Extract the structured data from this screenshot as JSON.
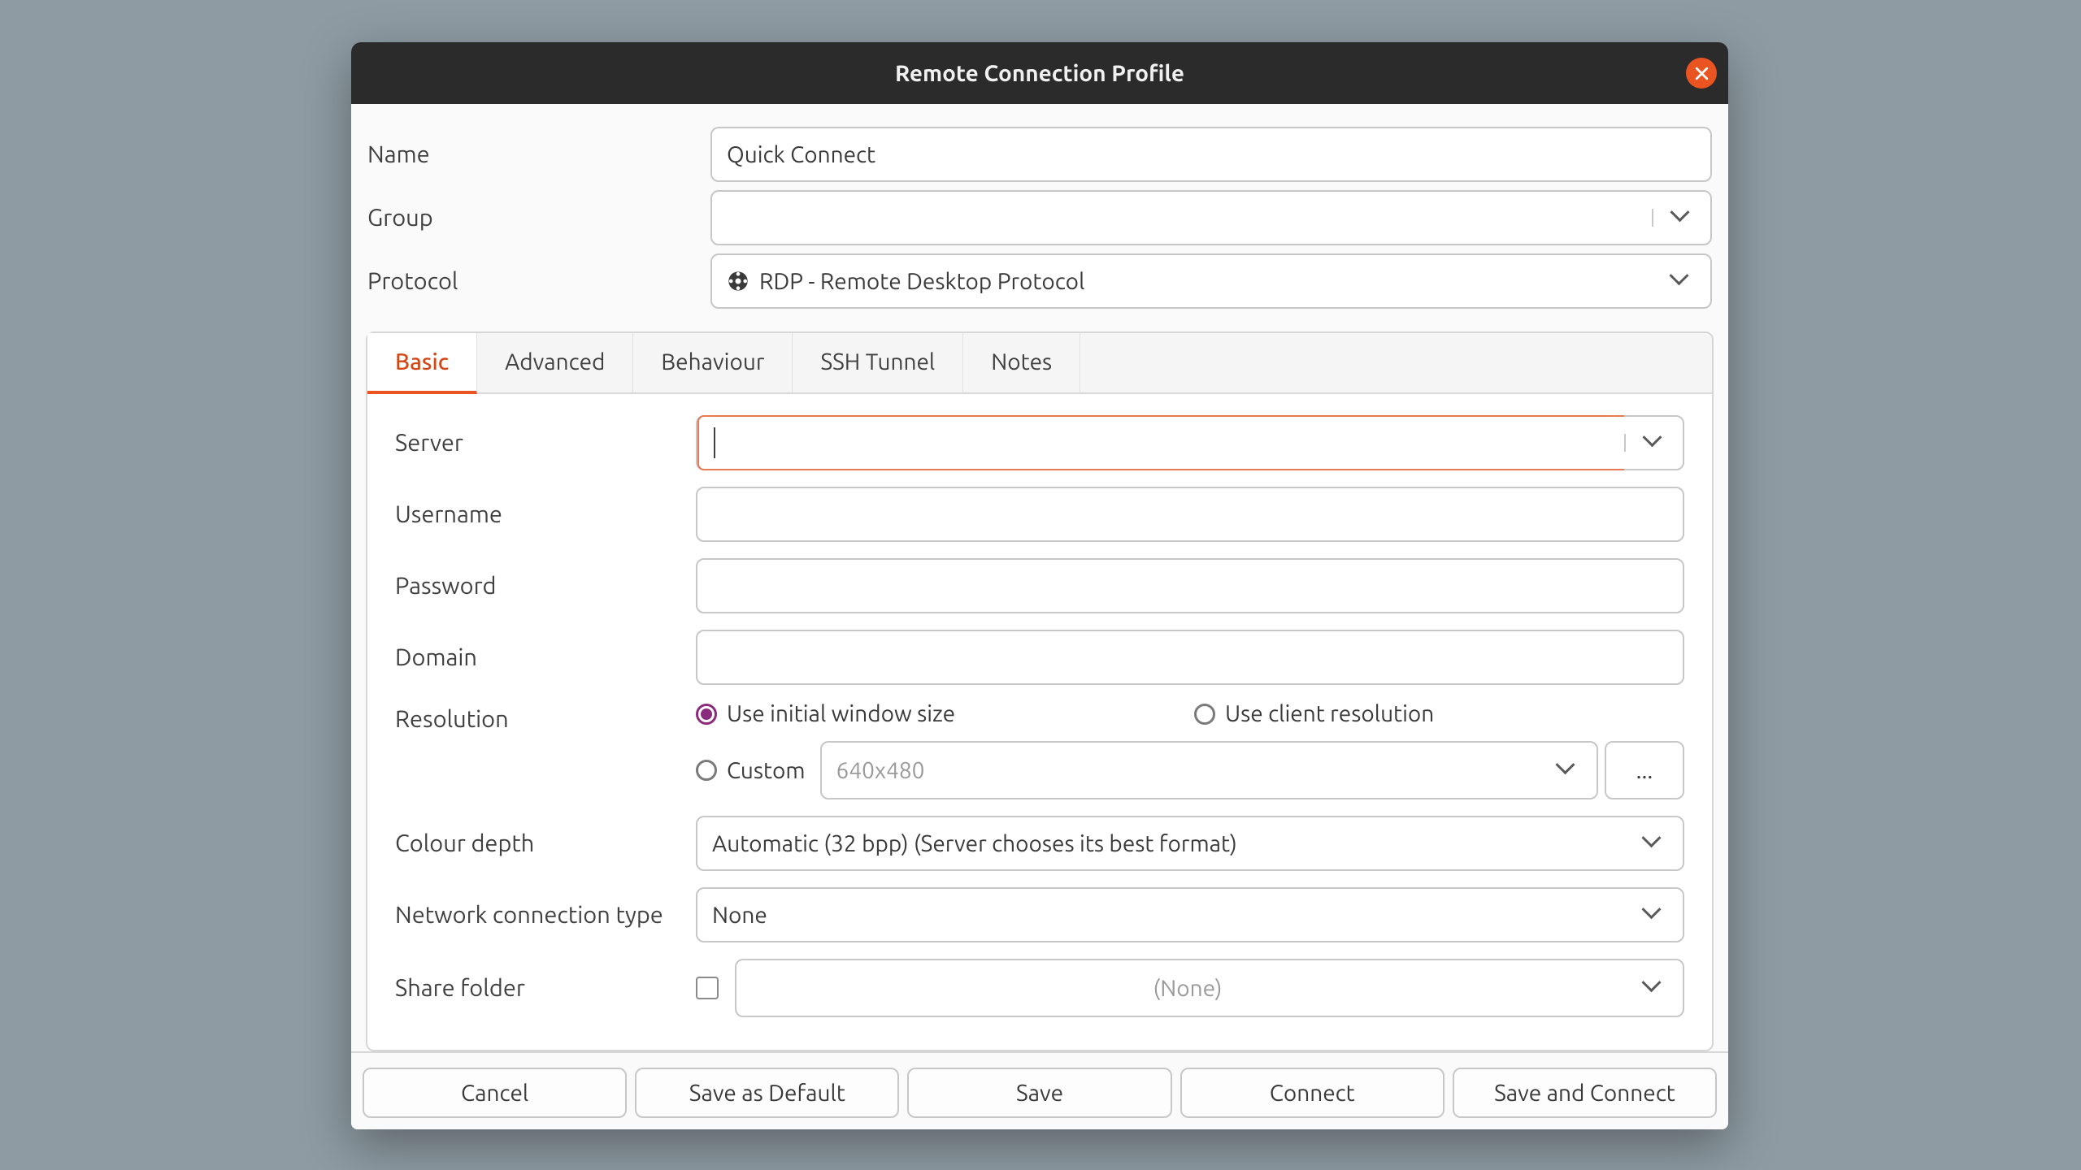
{
  "title": "Remote Connection Profile",
  "labels": {
    "name": "Name",
    "group": "Group",
    "protocol": "Protocol"
  },
  "values": {
    "name": "Quick Connect",
    "group": "",
    "protocol": "RDP - Remote Desktop Protocol"
  },
  "tabs": {
    "basic": "Basic",
    "advanced": "Advanced",
    "behaviour": "Behaviour",
    "ssh": "SSH Tunnel",
    "notes": "Notes"
  },
  "basic": {
    "server": "Server",
    "username": "Username",
    "password": "Password",
    "domain": "Domain",
    "resolution": "Resolution",
    "res_opt1": "Use initial window size",
    "res_opt2": "Use client resolution",
    "res_opt3": "Custom",
    "res_custom_value": "640x480",
    "more": "...",
    "colourdepth": "Colour depth",
    "colourdepth_value": "Automatic (32 bpp) (Server chooses its best format)",
    "nettype": "Network connection type",
    "nettype_value": "None",
    "share": "Share folder",
    "share_value": "(None)"
  },
  "buttons": {
    "cancel": "Cancel",
    "savedefault": "Save as Default",
    "save": "Save",
    "connect": "Connect",
    "saveconnect": "Save and Connect"
  }
}
